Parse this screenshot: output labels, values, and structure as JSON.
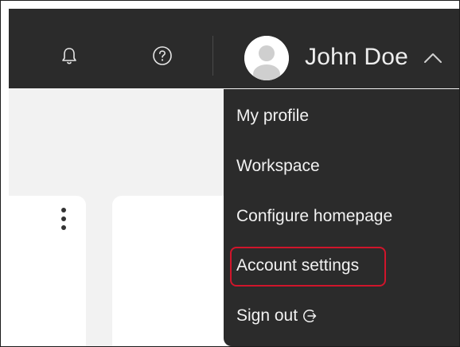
{
  "header": {
    "user_name": "John Doe",
    "icons": {
      "notifications": "bell-icon",
      "help": "question-circle-icon",
      "expand": "chevron-up-icon",
      "avatar": "user-avatar"
    }
  },
  "menu": {
    "items": [
      {
        "label": "My profile"
      },
      {
        "label": "Workspace"
      },
      {
        "label": "Configure homepage"
      },
      {
        "label": "Account settings",
        "highlighted": true
      },
      {
        "label": "Sign out",
        "icon": "sign-out-arrow-icon"
      }
    ]
  },
  "colors": {
    "header_bg": "#2b2b2b",
    "menu_bg": "#2b2b2b",
    "highlight_border": "#d0152b",
    "text_light": "#f2f2f2",
    "content_bg": "#f2f2f2"
  }
}
